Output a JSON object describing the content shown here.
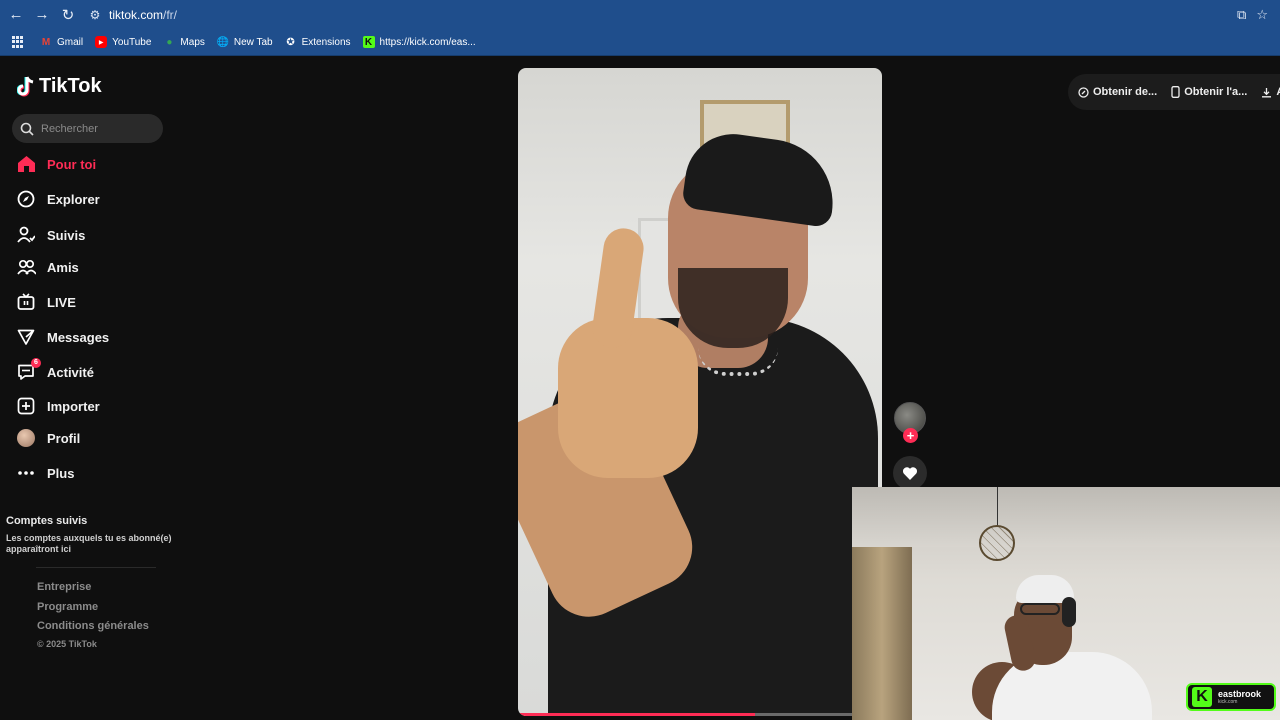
{
  "browser": {
    "url_host": "tiktok.com",
    "url_path": "/fr/",
    "bookmarks": [
      {
        "label": "Gmail",
        "icon": "gmail-icon"
      },
      {
        "label": "YouTube",
        "icon": "youtube-icon"
      },
      {
        "label": "Maps",
        "icon": "maps-icon"
      },
      {
        "label": "New Tab",
        "icon": "globe-icon"
      },
      {
        "label": "Extensions",
        "icon": "puzzle-icon"
      },
      {
        "label": "https://kick.com/eas...",
        "icon": "kick-icon"
      }
    ]
  },
  "tiktok": {
    "logo": "TikTok",
    "search_placeholder": "Rechercher",
    "menu": [
      {
        "label": "Pour toi",
        "icon": "home-icon",
        "active": true
      },
      {
        "label": "Explorer",
        "icon": "compass-icon"
      },
      {
        "label": "Suivis",
        "icon": "following-icon"
      },
      {
        "label": "Amis",
        "icon": "friends-icon"
      },
      {
        "label": "LIVE",
        "icon": "live-icon"
      },
      {
        "label": "Messages",
        "icon": "messages-icon"
      },
      {
        "label": "Activité",
        "icon": "activity-icon",
        "badge": "6"
      },
      {
        "label": "Importer",
        "icon": "upload-icon"
      },
      {
        "label": "Profil",
        "icon": "profile-avatar"
      },
      {
        "label": "Plus",
        "icon": "more-icon"
      }
    ],
    "followed_title": "Comptes suivis",
    "followed_desc": "Les comptes auxquels tu es abonné(e) apparaîtront ici",
    "footer": [
      "Entreprise",
      "Programme",
      "Conditions générales"
    ],
    "copyright": "© 2025 TikTok",
    "top_actions": [
      "Obtenir de...",
      "Obtenir l'a...",
      "Ap"
    ],
    "video_progress": 0.65
  },
  "stream": {
    "kick_name": "eastbrook",
    "kick_sub": "kick.com"
  },
  "colors": {
    "accent": "#fe2c55",
    "kick_green": "#53fc18",
    "chrome_blue": "#1f4e8c"
  }
}
